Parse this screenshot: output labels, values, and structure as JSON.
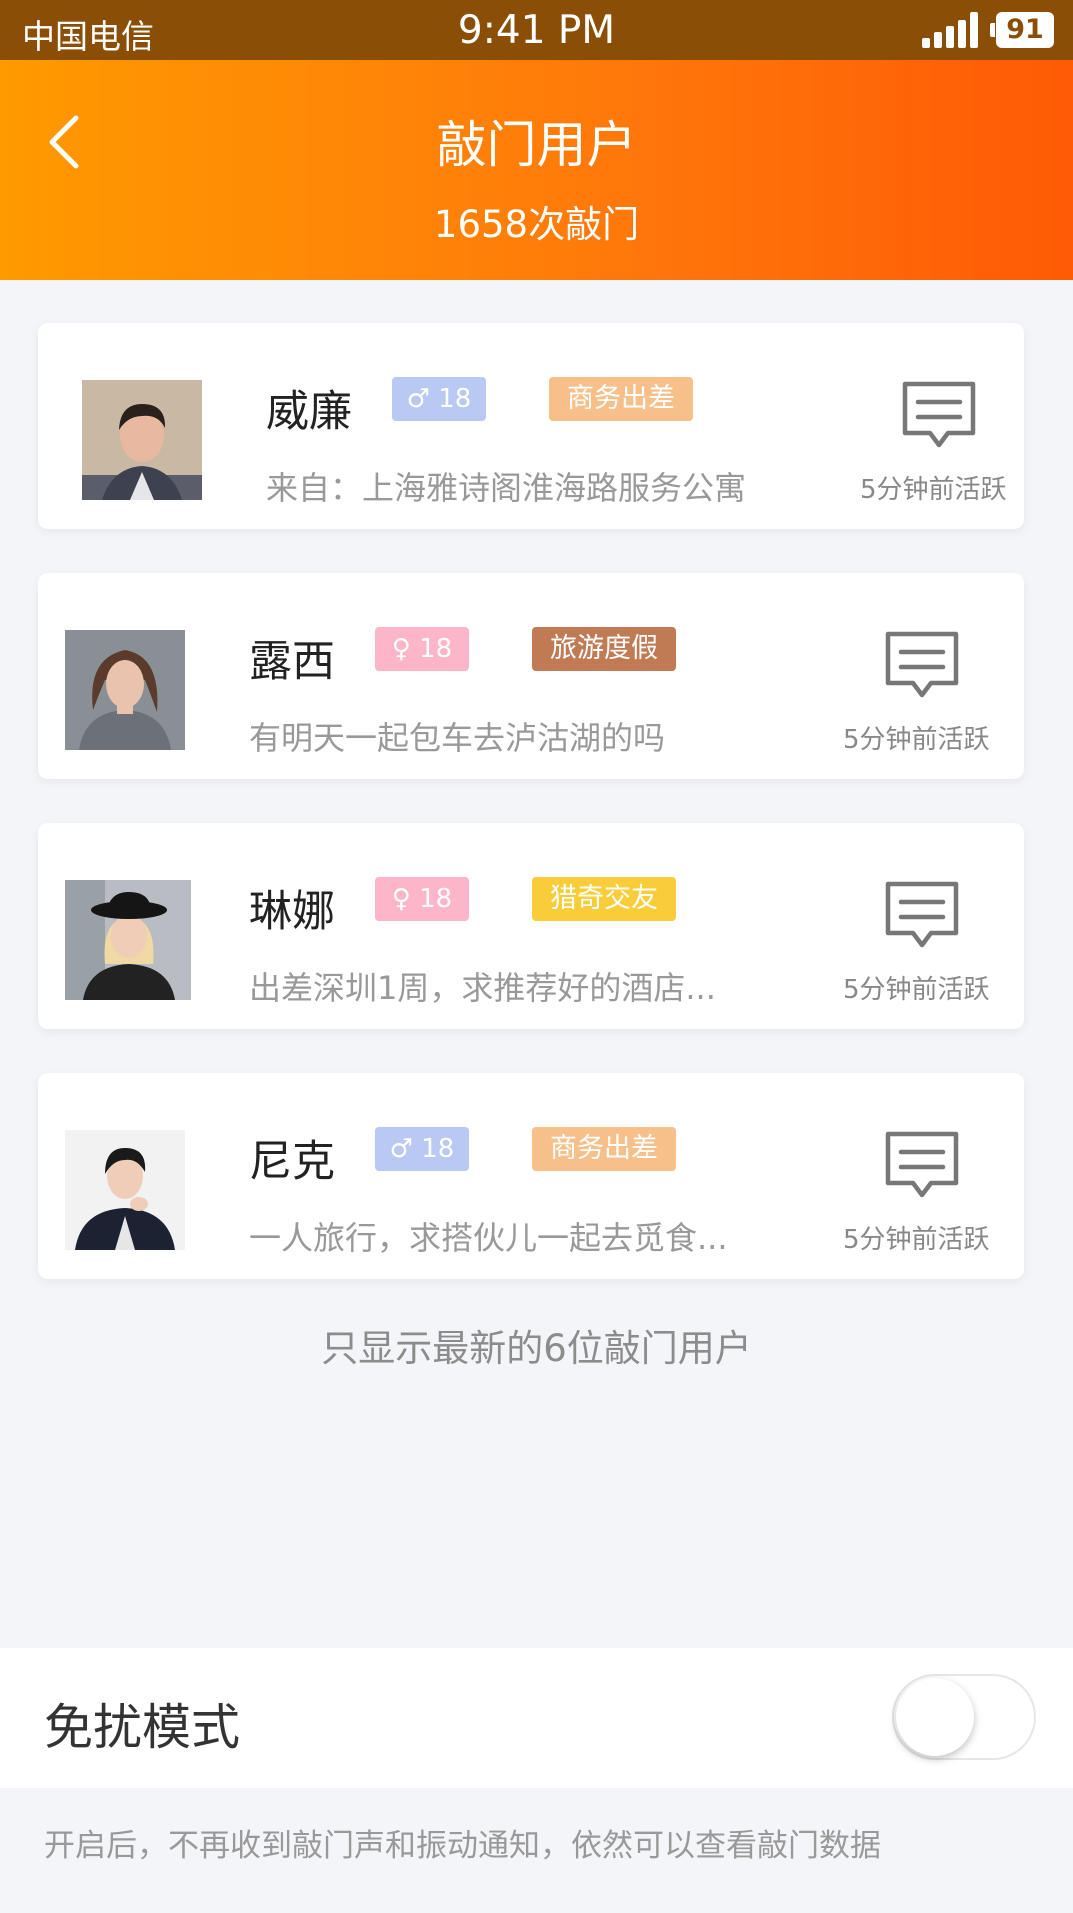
{
  "status_bar": {
    "carrier": "中国电信",
    "time": "9:41 PM",
    "battery": "91"
  },
  "header": {
    "title": "敲门用户",
    "subtitle": "1658次敲门"
  },
  "users": [
    {
      "name": "威廉",
      "gender": "male",
      "gender_symbol": "♂",
      "age": "18",
      "tag": "商务出差",
      "tag_color": "#f7c08a",
      "description": "来自：上海雅诗阁淮海路服务公寓",
      "active": "5分钟前活跃"
    },
    {
      "name": "露西",
      "gender": "female",
      "gender_symbol": "♀",
      "age": "18",
      "tag": "旅游度假",
      "tag_color": "#c07b55",
      "description": "有明天一起包车去泸沽湖的吗",
      "active": "5分钟前活跃"
    },
    {
      "name": "琳娜",
      "gender": "female",
      "gender_symbol": "♀",
      "age": "18",
      "tag": "猎奇交友",
      "tag_color": "#f9cd39",
      "description": "出差深圳1周，求推荐好的酒店...",
      "active": "5分钟前活跃"
    },
    {
      "name": "尼克",
      "gender": "male",
      "gender_symbol": "♂",
      "age": "18",
      "tag": "商务出差",
      "tag_color": "#f7c08a",
      "description": "一人旅行，求搭伙儿一起去觅食...",
      "active": "5分钟前活跃"
    }
  ],
  "footer_note": "只显示最新的6位敲门用户",
  "dnd": {
    "label": "免扰模式",
    "enabled": false,
    "description": "开启后，不再收到敲门声和振动通知，依然可以查看敲门数据"
  },
  "colors": {
    "status_bar": "#8a4e06",
    "header_start": "#ff9a00",
    "header_end": "#ff5a06",
    "male_badge": "#b9c9f3",
    "female_badge": "#fdb6c9"
  }
}
